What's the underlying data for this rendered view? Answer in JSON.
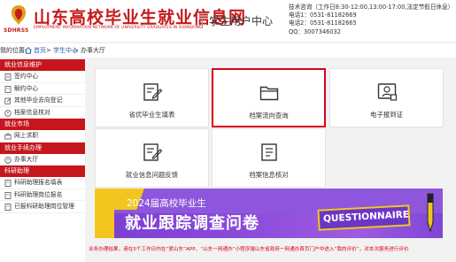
{
  "header": {
    "logo_sub": "SDHRSS",
    "title": "山东高校毕业生就业信息网",
    "subtitle_en": "EMPLOYMENT INFORMATION NETWORK OF UNIVERSITY GRADUATES IN SHANDONG",
    "center": "学生用户中心",
    "contact": [
      "技术咨询（工作日8:30-12:00,13:00-17:00,法定节假日休息）",
      "电话1：0531-81182669",
      "电话2：0531-81182665",
      "QQ：3007346032"
    ]
  },
  "breadcrumb": {
    "prefix": "我的位置:",
    "home": "首页",
    "section": "学生中心",
    "current": "办事大厅"
  },
  "sidebar": {
    "groups": [
      {
        "title": "就业信息维护",
        "items": [
          "签约中心",
          "解约中心",
          "其他毕业去向登记",
          "档案信息核对"
        ]
      },
      {
        "title": "就业市场",
        "items": [
          "网上求职"
        ]
      },
      {
        "title": "就业手续办理",
        "items": [
          "办事大厅"
        ]
      },
      {
        "title": "科研助理",
        "items": [
          "科研助理报名填表",
          "科研助理岗位报名",
          "已报科研助理岗位管理"
        ]
      }
    ]
  },
  "cards": [
    {
      "label": "省优毕业生填表",
      "icon": "form-edit-icon"
    },
    {
      "label": "档案流向查询",
      "icon": "folder-icon"
    },
    {
      "label": "电子报到证",
      "icon": "certificate-user-icon"
    },
    {
      "label": "就业信息问题反馈",
      "icon": "feedback-edit-icon"
    },
    {
      "label": "档案信息核对",
      "icon": "checklist-icon"
    }
  ],
  "banner": {
    "year_line": "2024届高校毕业生",
    "title": "就业跟踪调查问卷",
    "badge": "QUESTIONNAIRE"
  },
  "notice": "业务办理结果，请在5个工作日内在“爱山东”APP、“山东一网通办”小程序搜山东省政府一网通办首页门户中进入“我的评价”，对本次服务进行评价"
}
